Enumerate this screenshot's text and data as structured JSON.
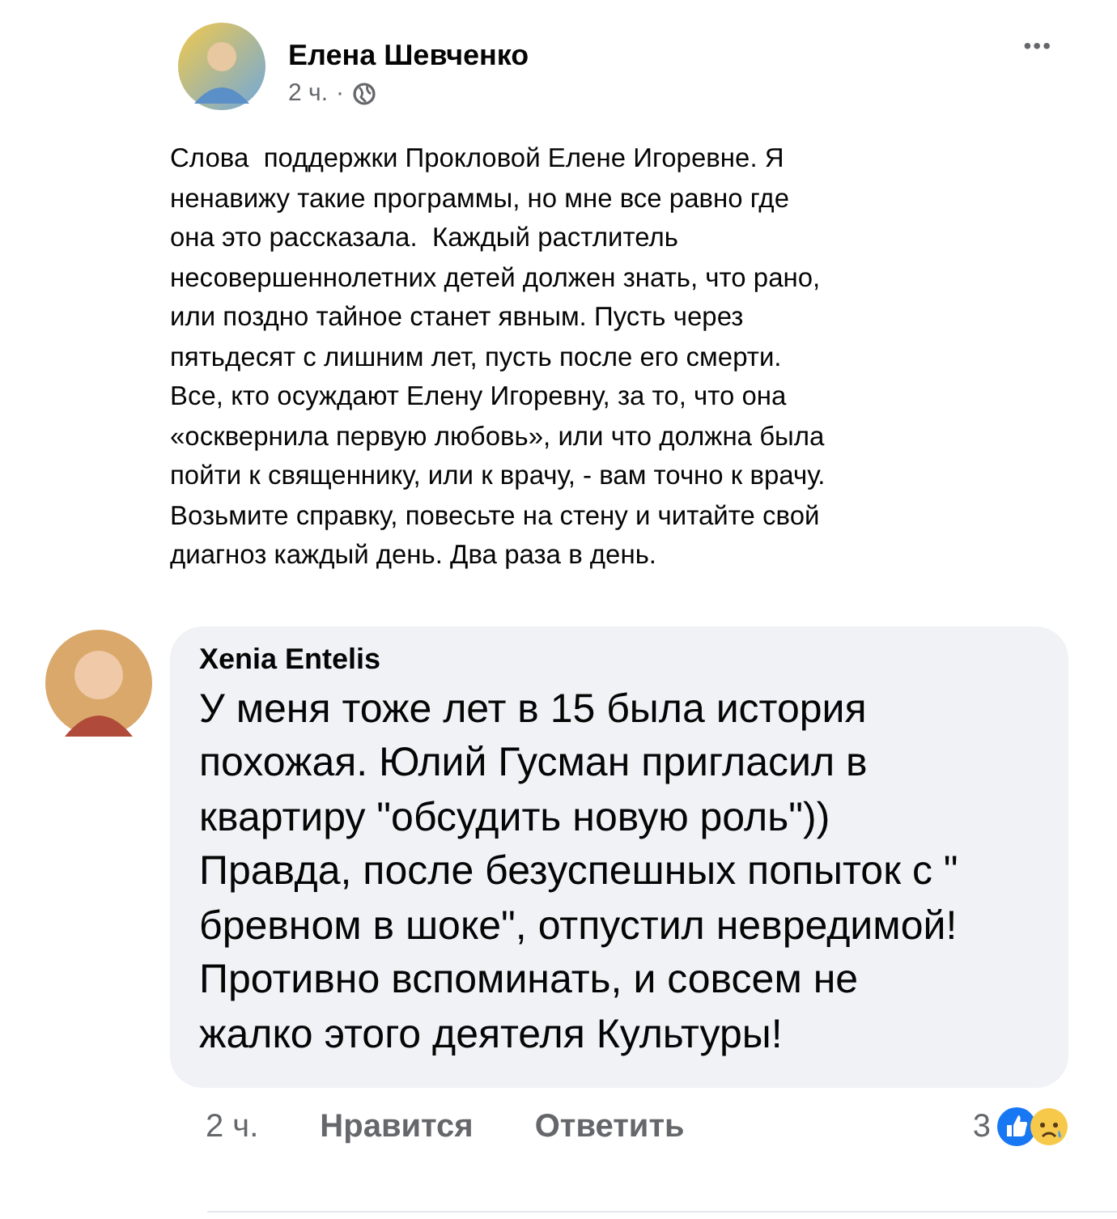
{
  "post": {
    "author": "Елена Шевченко",
    "time": "2 ч.",
    "separator": "·",
    "menu": "•••",
    "lines": [
      "Слова  поддержки Прокловой Елене Игоревне. Я",
      "ненавижу такие программы, но мне все равно где",
      "она это рассказала.  Каждый растлитель",
      "несовершеннолетних детей должен знать, что рано,",
      "или поздно тайное станет явным. Пусть через",
      "пятьдесят с лишним лет, пусть после его смерти.",
      "Все, кто осуждают Елену Игоревну, за то, что она",
      "«осквернила первую любовь», или что должна была",
      "пойти к священнику, или к врачу, - вам точно к врачу.",
      "Возьмите справку, повесьте на стену и читайте свой",
      "диагноз каждый день. Два раза в день."
    ]
  },
  "comment": {
    "author": "Xenia Entelis",
    "lines": [
      "У меня тоже лет в 15 была история",
      "похожая. Юлий Гусман пригласил в",
      "квартиру \"обсудить новую роль\"))",
      "Правда, после безуспешных попыток с \"",
      "бревном в шоке\", отпустил невредимой!",
      "Противно вспоминать, и совсем не",
      "жалко этого деятеля Культуры!"
    ],
    "time": "2 ч.",
    "actions": [
      "Нравится",
      "Ответить"
    ],
    "reaction_count": "3"
  }
}
